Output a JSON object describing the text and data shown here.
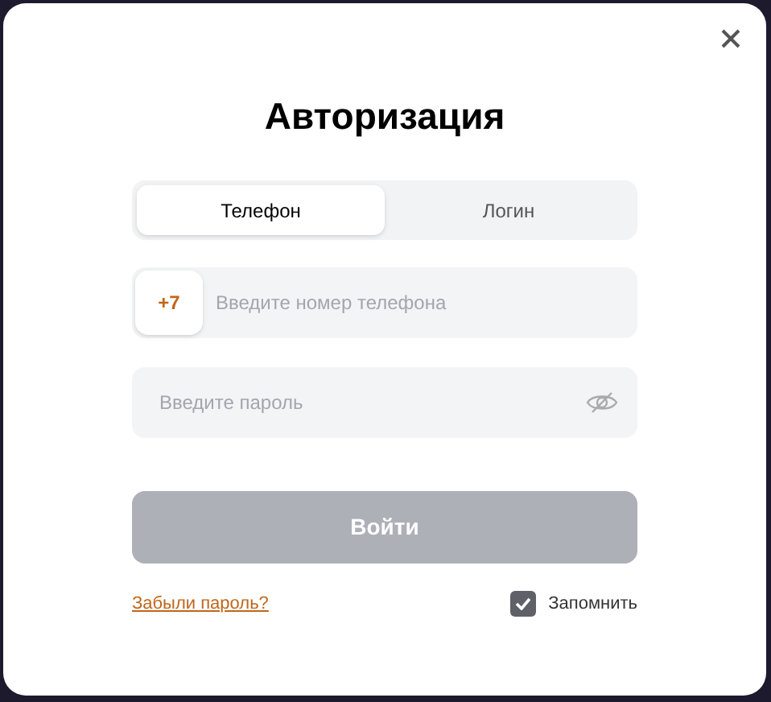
{
  "dialog": {
    "title": "Авторизация"
  },
  "tabs": [
    {
      "label": "Телефон",
      "selected": true
    },
    {
      "label": "Логин",
      "selected": false
    }
  ],
  "phone": {
    "prefix": "+7",
    "placeholder": "Введите номер телефона"
  },
  "password": {
    "placeholder": "Введите пароль"
  },
  "submit": {
    "label": "Войти",
    "disabled": true
  },
  "forgot_link": "Забыли пароль?",
  "remember": {
    "label": "Запомнить",
    "checked": true
  }
}
